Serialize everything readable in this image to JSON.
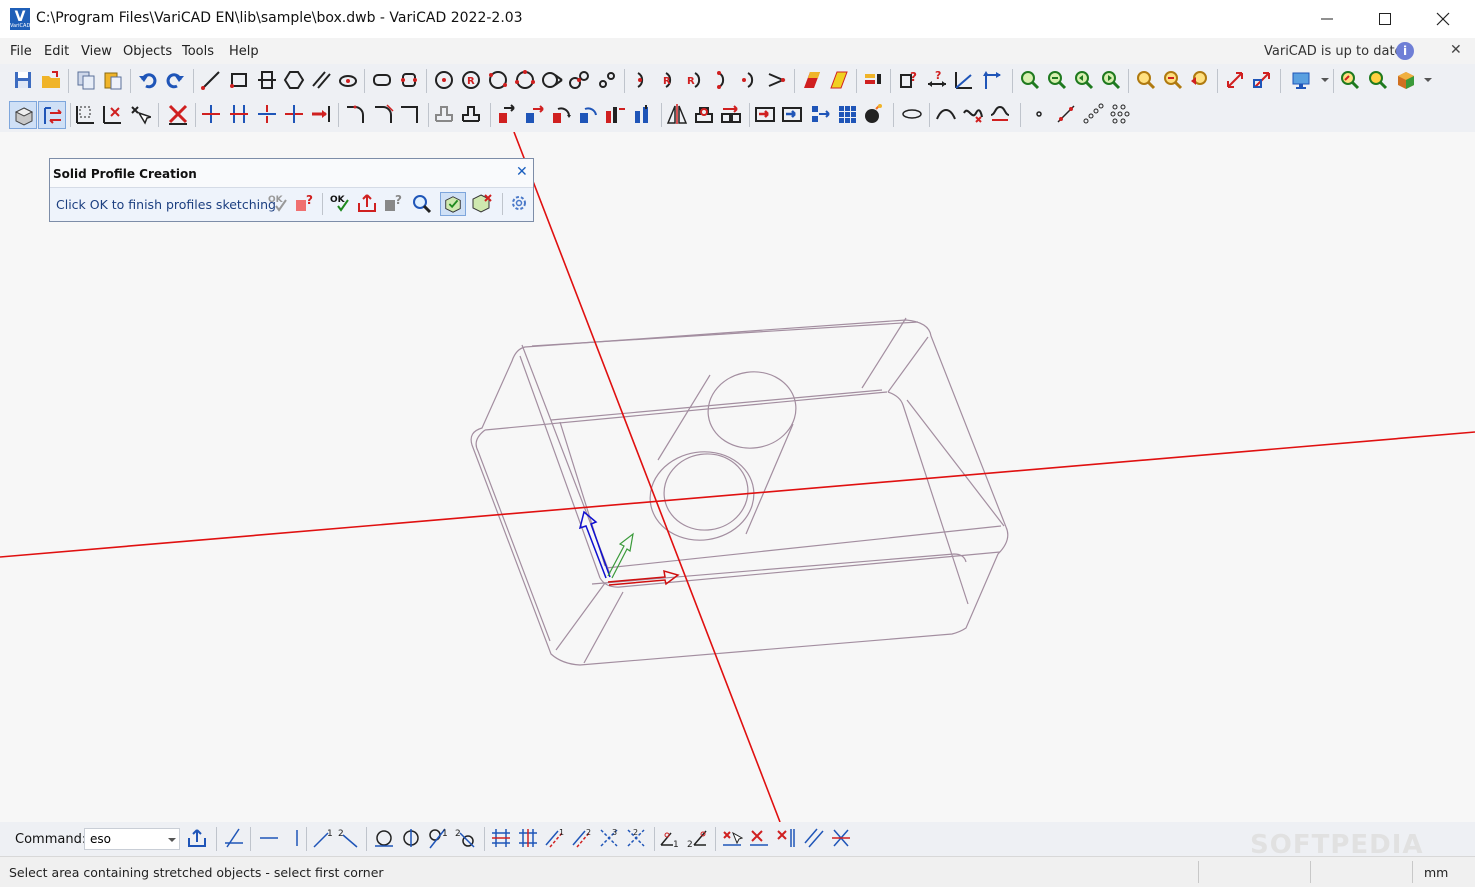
{
  "window": {
    "title": "C:\\Program Files\\VariCAD EN\\lib\\sample\\box.dwb - VariCAD 2022-2.03",
    "logo_letter": "V",
    "logo_caption": "VariCAD"
  },
  "menu": {
    "items": [
      "File",
      "Edit",
      "View",
      "Objects",
      "Tools",
      "Help"
    ],
    "update_status": "VariCAD is up to date"
  },
  "panel": {
    "title": "Solid Profile Creation",
    "message": "Click OK to finish profiles sketching"
  },
  "command": {
    "label": "Command:",
    "value": "eso"
  },
  "status": {
    "message": "Select area containing stretched objects - select first corner",
    "units": "mm"
  },
  "watermark": "SOFTPEDIA",
  "colors": {
    "axis": "#e01010",
    "model_edges": "#a38ea0",
    "toolbar_bg": "#eef0f4",
    "accent_blue": "#1b5fbf"
  }
}
